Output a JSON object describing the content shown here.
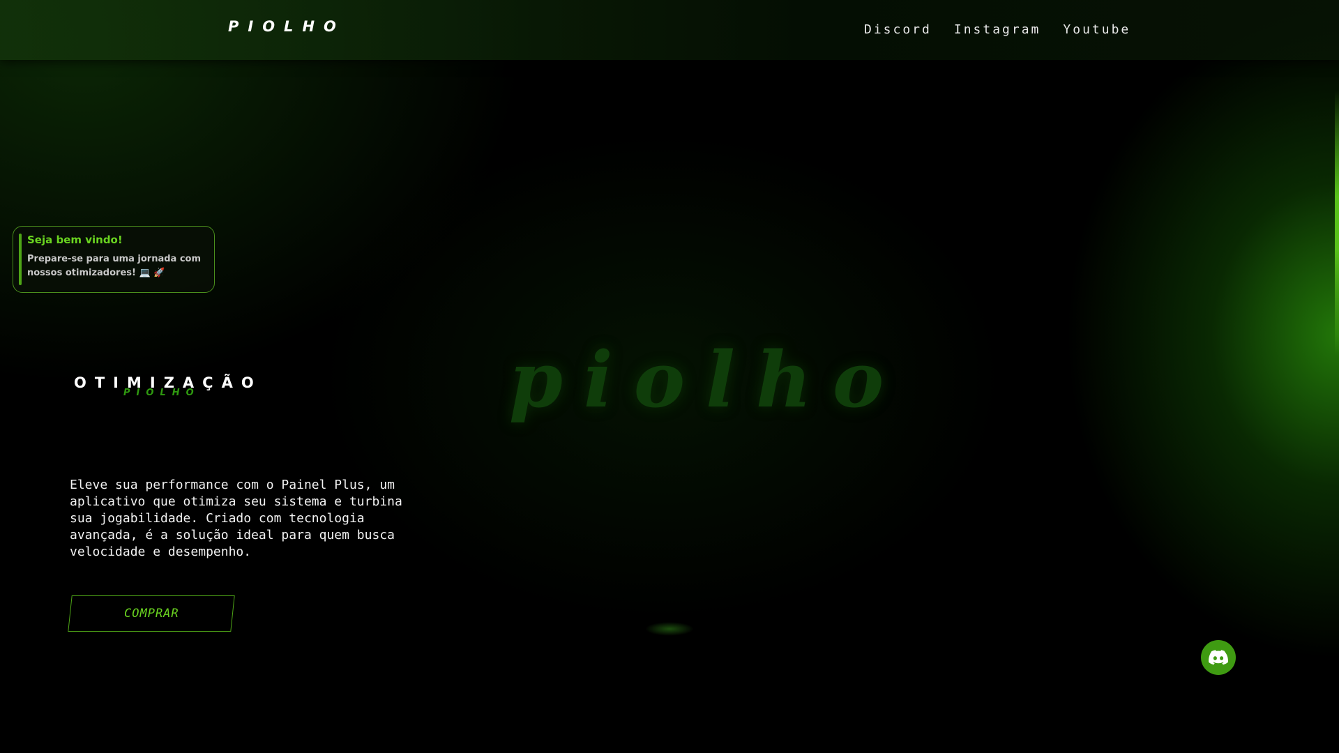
{
  "header": {
    "logo": "PIOLHO",
    "nav": [
      "Discord",
      "Instagram",
      "Youtube"
    ]
  },
  "toast": {
    "title": "Seja bem vindo!",
    "message": "Prepare-se para uma jornada com nossos otimizadores! 💻 🚀"
  },
  "hero": {
    "background_title": "piolho",
    "heading": "OTIMIZAÇÃO",
    "subheading": "PIOLHO",
    "description": "Eleve sua performance com o Painel Plus, um aplicativo que otimiza seu sistema e turbina sua jogabilidade. Criado com tecnologia avançada, é a solução ideal para quem busca velocidade e desempenho.",
    "cta_label": "COMPRAR"
  },
  "fab": {
    "icon": "discord-icon"
  },
  "colors": {
    "accent": "#4ea517",
    "accent_light": "#6ad420",
    "background": "#000000"
  }
}
